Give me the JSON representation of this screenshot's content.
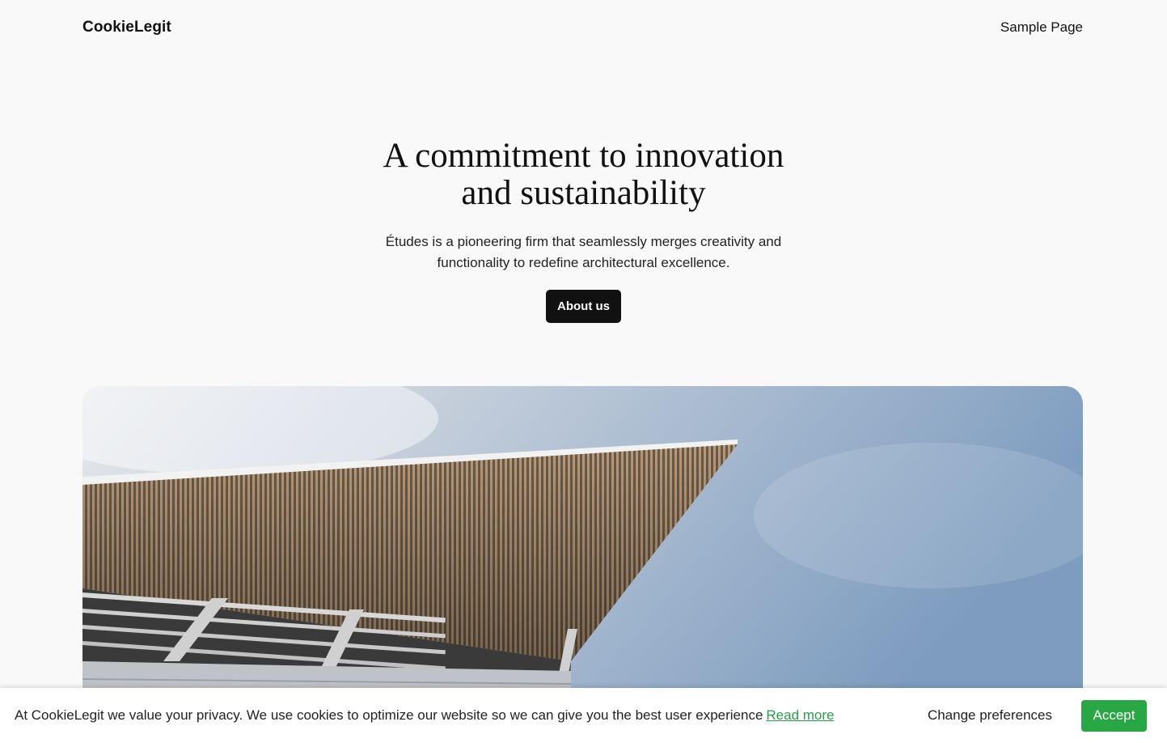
{
  "header": {
    "site_title": "CookieLegit",
    "nav": [
      {
        "label": "Sample Page"
      }
    ]
  },
  "hero": {
    "heading_line1": "A commitment to innovation",
    "heading_line2": "and sustainability",
    "subtext_line1": "Études is a pioneering firm that seamlessly merges creativity and",
    "subtext_line2": "functionality to redefine architectural excellence.",
    "button_label": "About us"
  },
  "hero_image": {
    "subject": "modern-building-canopy-photo"
  },
  "cookie_bar": {
    "message": "At CookieLegit we value your privacy. We use cookies to optimize our website so we can give you the best user experience",
    "read_more_label": "Read more",
    "change_preferences_label": "Change preferences",
    "accept_label": "Accept",
    "accent_color": "#28a745"
  }
}
